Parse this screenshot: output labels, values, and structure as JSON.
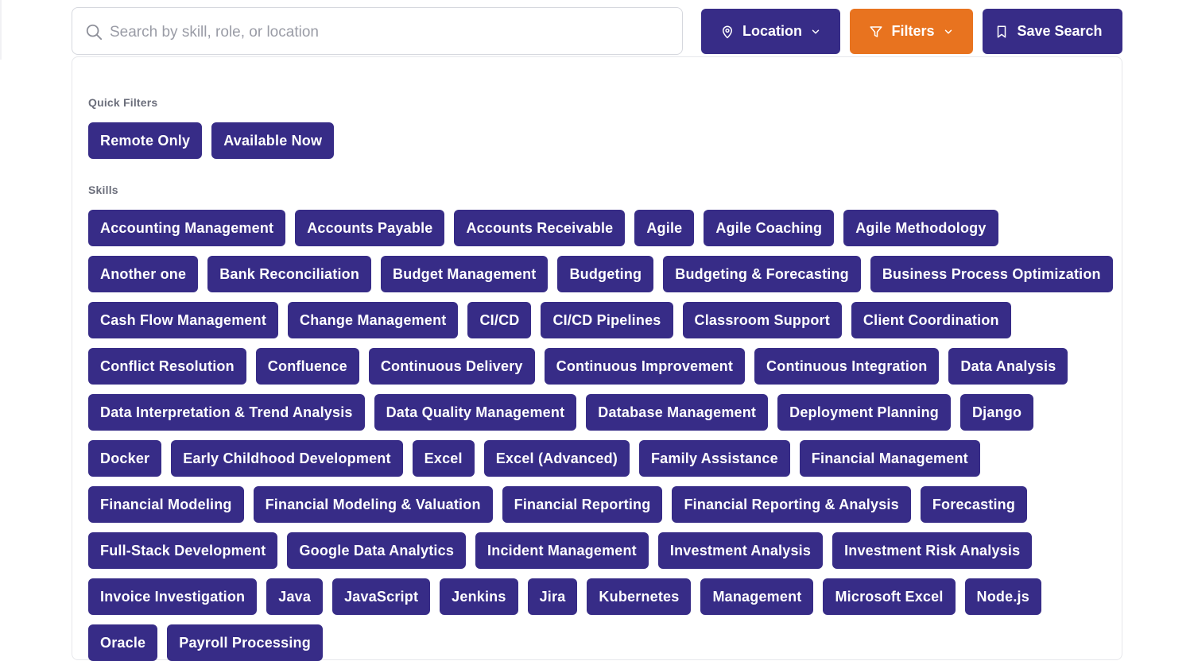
{
  "search": {
    "placeholder": "Search by skill, role, or location",
    "value": ""
  },
  "toolbar": {
    "location_label": "Location",
    "filters_label": "Filters",
    "save_label": "Save Search"
  },
  "colors": {
    "primary": "#372c87",
    "accent": "#e8731f"
  },
  "quick_filters": {
    "label": "Quick Filters",
    "items": [
      "Remote Only",
      "Available Now"
    ]
  },
  "skills": {
    "label": "Skills",
    "items": [
      "Accounting Management",
      "Accounts Payable",
      "Accounts Receivable",
      "Agile",
      "Agile Coaching",
      "Agile Methodology",
      "Another one",
      "Bank Reconciliation",
      "Budget Management",
      "Budgeting",
      "Budgeting & Forecasting",
      "Business Process Optimization",
      "Cash Flow Management",
      "Change Management",
      "CI/CD",
      "CI/CD Pipelines",
      "Classroom Support",
      "Client Coordination",
      "Conflict Resolution",
      "Confluence",
      "Continuous Delivery",
      "Continuous Improvement",
      "Continuous Integration",
      "Data Analysis",
      "Data Interpretation & Trend Analysis",
      "Data Quality Management",
      "Database Management",
      "Deployment Planning",
      "Django",
      "Docker",
      "Early Childhood Development",
      "Excel",
      "Excel (Advanced)",
      "Family Assistance",
      "Financial Management",
      "Financial Modeling",
      "Financial Modeling & Valuation",
      "Financial Reporting",
      "Financial Reporting & Analysis",
      "Forecasting",
      "Full-Stack Development",
      "Google Data Analytics",
      "Incident Management",
      "Investment Analysis",
      "Investment Risk Analysis",
      "Invoice Investigation",
      "Java",
      "JavaScript",
      "Jenkins",
      "Jira",
      "Kubernetes",
      "Management",
      "Microsoft Excel",
      "Node.js",
      "Oracle",
      "Payroll Processing"
    ]
  }
}
